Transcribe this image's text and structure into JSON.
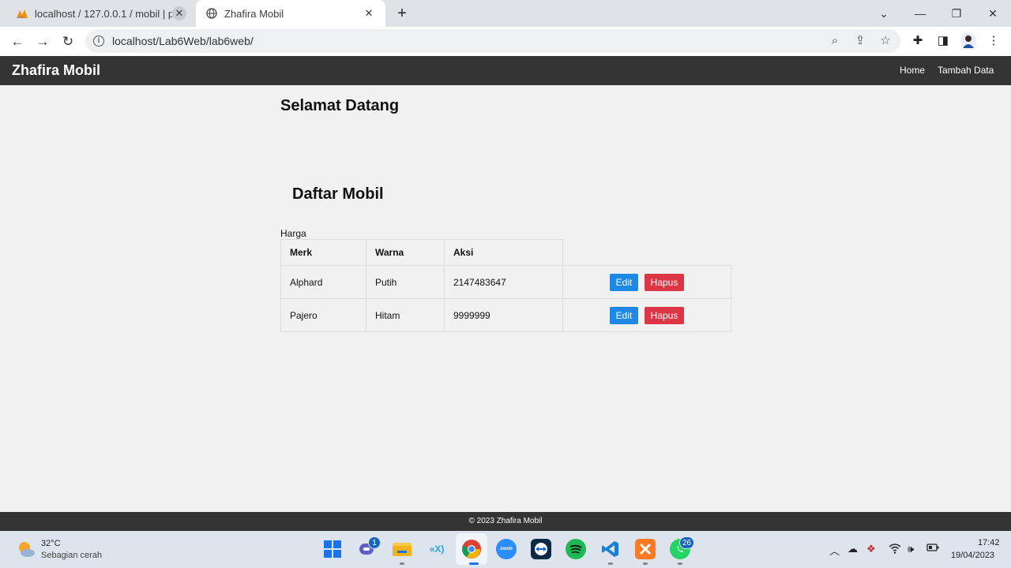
{
  "browser": {
    "tabs": [
      {
        "title": "localhost / 127.0.0.1 / mobil | php",
        "active": false
      },
      {
        "title": "Zhafira Mobil",
        "active": true
      }
    ],
    "url": "localhost/Lab6Web/lab6web/"
  },
  "page": {
    "brand": "Zhafira Mobil",
    "nav": [
      "Home",
      "Tambah Data"
    ],
    "welcome": "Selamat Datang",
    "list_heading": "Daftar Mobil",
    "table_caption": "Harga",
    "table": {
      "headers": [
        "Merk",
        "Warna",
        "Aksi"
      ],
      "rows": [
        {
          "merk": "Alphard",
          "warna": "Putih",
          "harga": "2147483647"
        },
        {
          "merk": "Pajero",
          "warna": "Hitam",
          "harga": "9999999"
        }
      ],
      "edit_label": "Edit",
      "delete_label": "Hapus"
    },
    "footer": "© 2023 Zhafira Mobil",
    "colors": {
      "navbar": "#333333",
      "edit": "#1e88e5",
      "delete": "#dc3545"
    }
  },
  "taskbar": {
    "weather": {
      "temp": "32°C",
      "desc": "Sebagian cerah"
    },
    "apps": [
      "windows-start",
      "teams",
      "file-explorer",
      "dev-app",
      "chrome",
      "zoom",
      "teamviewer",
      "spotify",
      "vscode",
      "xampp",
      "whatsapp"
    ],
    "badges": {
      "teams": "1",
      "whatsapp": "26"
    },
    "zoom_label": "zoom",
    "time": "17:42",
    "date": "19/04/2023"
  }
}
